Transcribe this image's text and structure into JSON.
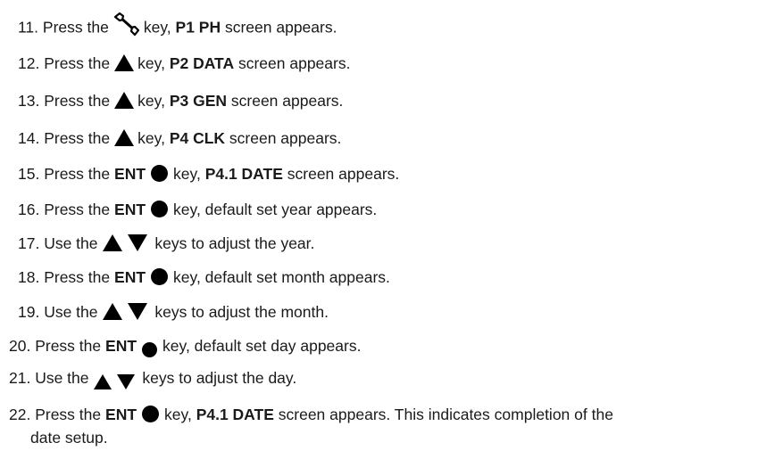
{
  "steps": [
    {
      "num": "11.",
      "pre": "Press the",
      "key": "",
      "post": "key,",
      "bold": "P1 PH",
      "tail": "screen appears."
    },
    {
      "num": "12.",
      "pre": "Press the",
      "key": "",
      "post": "key,",
      "bold": "P2 DATA",
      "tail": "screen appears."
    },
    {
      "num": "13.",
      "pre": "Press the",
      "key": "",
      "post": "key,",
      "bold": "P3 GEN",
      "tail": "screen appears."
    },
    {
      "num": "14.",
      "pre": "Press the",
      "key": "",
      "post": "key,",
      "bold": "P4 CLK",
      "tail": "screen appears."
    },
    {
      "num": "15.",
      "pre": "Press the",
      "key": "ENT",
      "post": "key,",
      "bold": "P4.1 DATE",
      "tail": "screen appears."
    },
    {
      "num": "16.",
      "pre": "Press the",
      "key": "ENT",
      "post": "key, default set year appears.",
      "bold": "",
      "tail": ""
    },
    {
      "num": "17.",
      "pre": "Use the",
      "key": "",
      "post": "keys to adjust the year.",
      "bold": "",
      "tail": ""
    },
    {
      "num": "18.",
      "pre": "Press the",
      "key": "ENT",
      "post": "key, default set month appears.",
      "bold": "",
      "tail": ""
    },
    {
      "num": "19.",
      "pre": "Use the",
      "key": "",
      "post": "keys to adjust the month.",
      "bold": "",
      "tail": ""
    },
    {
      "num": "20.",
      "pre": "Press the",
      "key": "ENT",
      "post": "key, default set day appears.",
      "bold": "",
      "tail": ""
    },
    {
      "num": "21.",
      "pre": "Use the",
      "key": "",
      "post": "keys to adjust the day.",
      "bold": "",
      "tail": ""
    },
    {
      "num": "22.",
      "pre": "Press the",
      "key": "ENT",
      "post": "key,",
      "bold": "P4.1 DATE",
      "tail": "screen appears. This indicates completion of the",
      "cont": "date setup."
    }
  ],
  "icons": {
    "wrench": "wrench-icon",
    "up": "up-triangle-icon",
    "down": "down-triangle-icon",
    "enter": "enter-dot-icon"
  }
}
